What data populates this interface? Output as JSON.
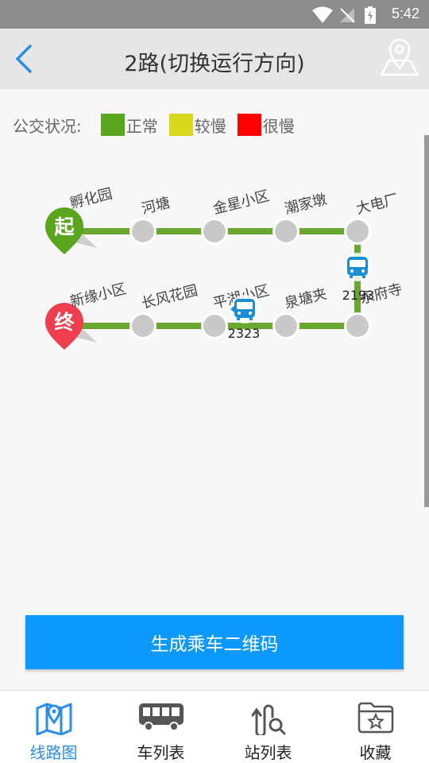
{
  "status_bar": {
    "time": "5:42"
  },
  "header": {
    "title": "2路(切换运行方向)",
    "back_icon": "chevron-left-icon",
    "map_icon": "map-pin-icon"
  },
  "legend": {
    "label": "公交状况:",
    "items": [
      {
        "label": "正常",
        "color": "#5aa51e"
      },
      {
        "label": "较慢",
        "color": "#d8d81a"
      },
      {
        "label": "很慢",
        "color": "#ff0000"
      }
    ]
  },
  "route": {
    "start_badge": "起",
    "end_badge": "终",
    "line_color": "#6aa630",
    "stops_top": [
      "孵化园",
      "河塘",
      "金星小区",
      "潮家墩",
      "大电厂"
    ],
    "stops_bottom": [
      "新缘小区",
      "长风花园",
      "平湖小区",
      "泉塘夹",
      "永府寺"
    ],
    "buses": [
      {
        "id": "2193",
        "position": "between 大电厂 and 永府寺"
      },
      {
        "id": "2323",
        "position": "at 平湖小区"
      }
    ]
  },
  "cta": {
    "label": "生成乘车二维码"
  },
  "tabs": [
    {
      "label": "线路图",
      "icon": "map-icon",
      "active": true
    },
    {
      "label": "车列表",
      "icon": "bus-icon",
      "active": false
    },
    {
      "label": "站列表",
      "icon": "route-search-icon",
      "active": false
    },
    {
      "label": "收藏",
      "icon": "favorite-folder-icon",
      "active": false
    }
  ]
}
